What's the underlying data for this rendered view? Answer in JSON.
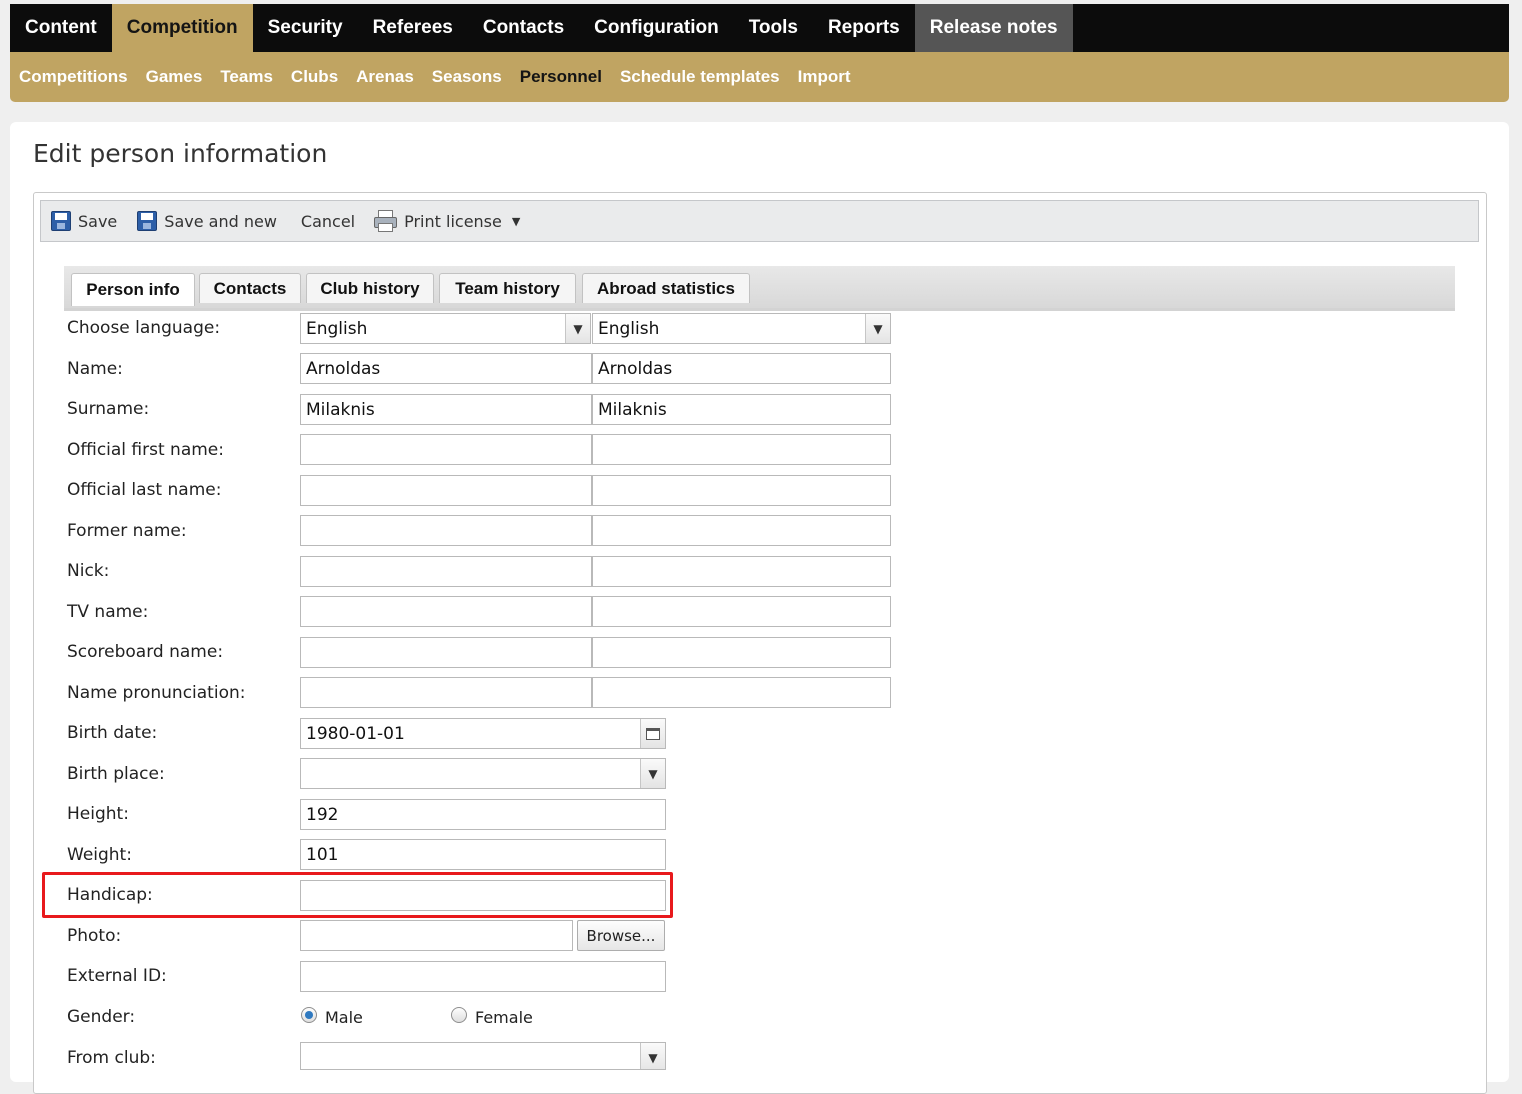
{
  "top_menu": [
    "Content",
    "Competition",
    "Security",
    "Referees",
    "Contacts",
    "Configuration",
    "Tools",
    "Reports",
    "Release notes"
  ],
  "top_menu_active": "Competition",
  "sub_menu": [
    "Competitions",
    "Games",
    "Teams",
    "Clubs",
    "Arenas",
    "Seasons",
    "Personnel",
    "Schedule templates",
    "Import"
  ],
  "sub_menu_active": "Personnel",
  "page_title": "Edit person information",
  "toolbar": {
    "save": "Save",
    "save_and_new": "Save and new",
    "cancel": "Cancel",
    "print_license": "Print license"
  },
  "tabs": [
    "Person info",
    "Contacts",
    "Club history",
    "Team history",
    "Abroad statistics"
  ],
  "active_tab": "Person info",
  "form": {
    "choose_language": {
      "label": "Choose language:",
      "value1": "English",
      "value2": "English"
    },
    "name": {
      "label": "Name:",
      "value1": "Arnoldas",
      "value2": "Arnoldas"
    },
    "surname": {
      "label": "Surname:",
      "value1": "Milaknis",
      "value2": "Milaknis"
    },
    "official_first_name": {
      "label": "Official first name:",
      "value1": "",
      "value2": ""
    },
    "official_last_name": {
      "label": "Official last name:",
      "value1": "",
      "value2": ""
    },
    "former_name": {
      "label": "Former name:",
      "value1": "",
      "value2": ""
    },
    "nick": {
      "label": "Nick:",
      "value1": "",
      "value2": ""
    },
    "tv_name": {
      "label": "TV name:",
      "value1": "",
      "value2": ""
    },
    "scoreboard_name": {
      "label": "Scoreboard name:",
      "value1": "",
      "value2": ""
    },
    "name_pronunciation": {
      "label": "Name pronunciation:",
      "value1": "",
      "value2": ""
    },
    "birth_date": {
      "label": "Birth date:",
      "value": "1980-01-01"
    },
    "birth_place": {
      "label": "Birth place:",
      "value": ""
    },
    "height": {
      "label": "Height:",
      "value": "192"
    },
    "weight": {
      "label": "Weight:",
      "value": "101"
    },
    "handicap": {
      "label": "Handicap:",
      "value": ""
    },
    "photo": {
      "label": "Photo:",
      "value": "",
      "browse": "Browse..."
    },
    "external_id": {
      "label": "External ID:",
      "value": ""
    },
    "gender": {
      "label": "Gender:",
      "options": [
        "Male",
        "Female"
      ],
      "selected": "Male"
    },
    "from_club": {
      "label": "From club:",
      "value": ""
    }
  },
  "colors": {
    "nav_bg": "#0c0c0c",
    "accent": "#c0a462",
    "release_bg": "#555555",
    "highlight": "#e8191c",
    "radio_selected": "#2f79c0"
  }
}
